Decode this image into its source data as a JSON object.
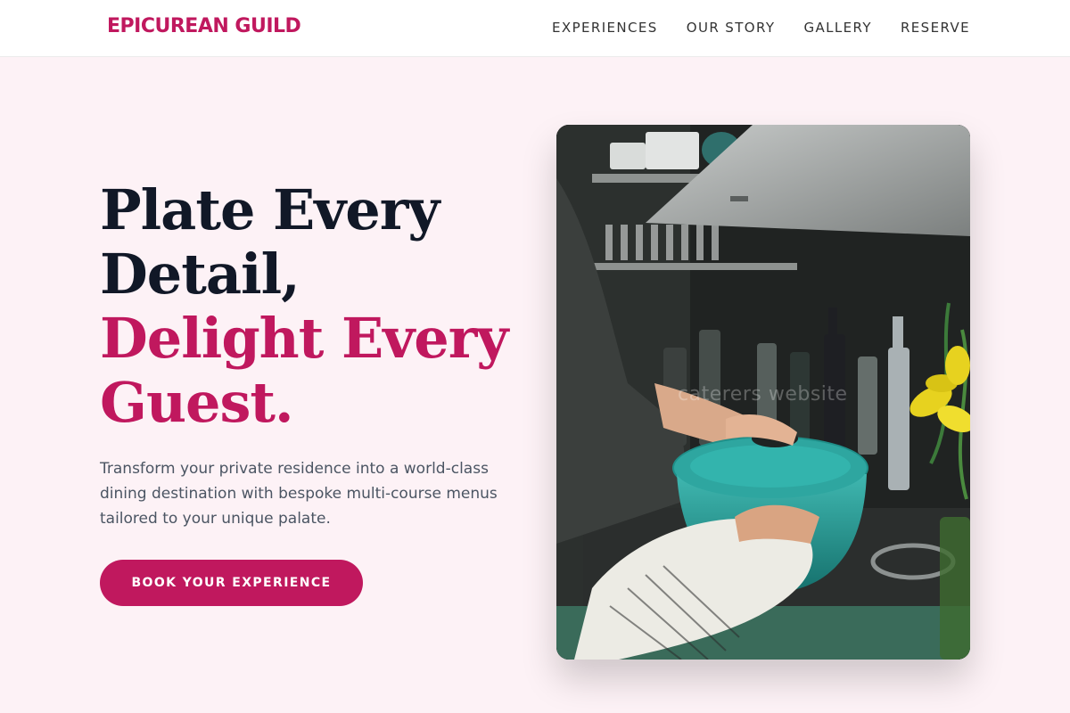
{
  "header": {
    "brand": "EPICUREAN GUILD",
    "nav": [
      "EXPERIENCES",
      "OUR STORY",
      "GALLERY",
      "RESERVE"
    ]
  },
  "hero": {
    "title_lines": [
      "Plate Every",
      "Detail,"
    ],
    "title_accent_lines": [
      "Delight Every",
      "Guest."
    ],
    "description": "Transform your private residence into a world-class dining destination with bespoke multi-course menus tailored to your unique palate.",
    "cta_label": "BOOK YOUR EXPERIENCE"
  },
  "image": {
    "watermark": "caterers website",
    "subject": "chef lifting lid of teal pot on stove"
  },
  "colors": {
    "accent": "#c0185e",
    "heading": "#111827",
    "background": "#fdf2f6"
  }
}
